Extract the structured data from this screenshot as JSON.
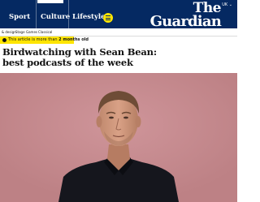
{
  "header": {
    "nav_items": [
      "Sport",
      "Culture",
      "Lifestyle"
    ],
    "active_item": "Culture",
    "logo": {
      "line1": "The",
      "line2": "Guardian"
    },
    "region": "UK",
    "region_icon": "chevron-down-icon",
    "menu_icon": "hamburger-icon"
  },
  "subnav": {
    "items": [
      "& design",
      "Stage",
      "Games",
      "Classical"
    ]
  },
  "age_warning": {
    "prefix": "This article is more than ",
    "age": "2 months old",
    "icon": "clock-icon"
  },
  "article": {
    "headline": "Birdwatching with Sean Bean: best podcasts of the week"
  },
  "colors": {
    "brand": "#052962",
    "highlight": "#ffe500",
    "photo_background": "#c58a8e"
  }
}
